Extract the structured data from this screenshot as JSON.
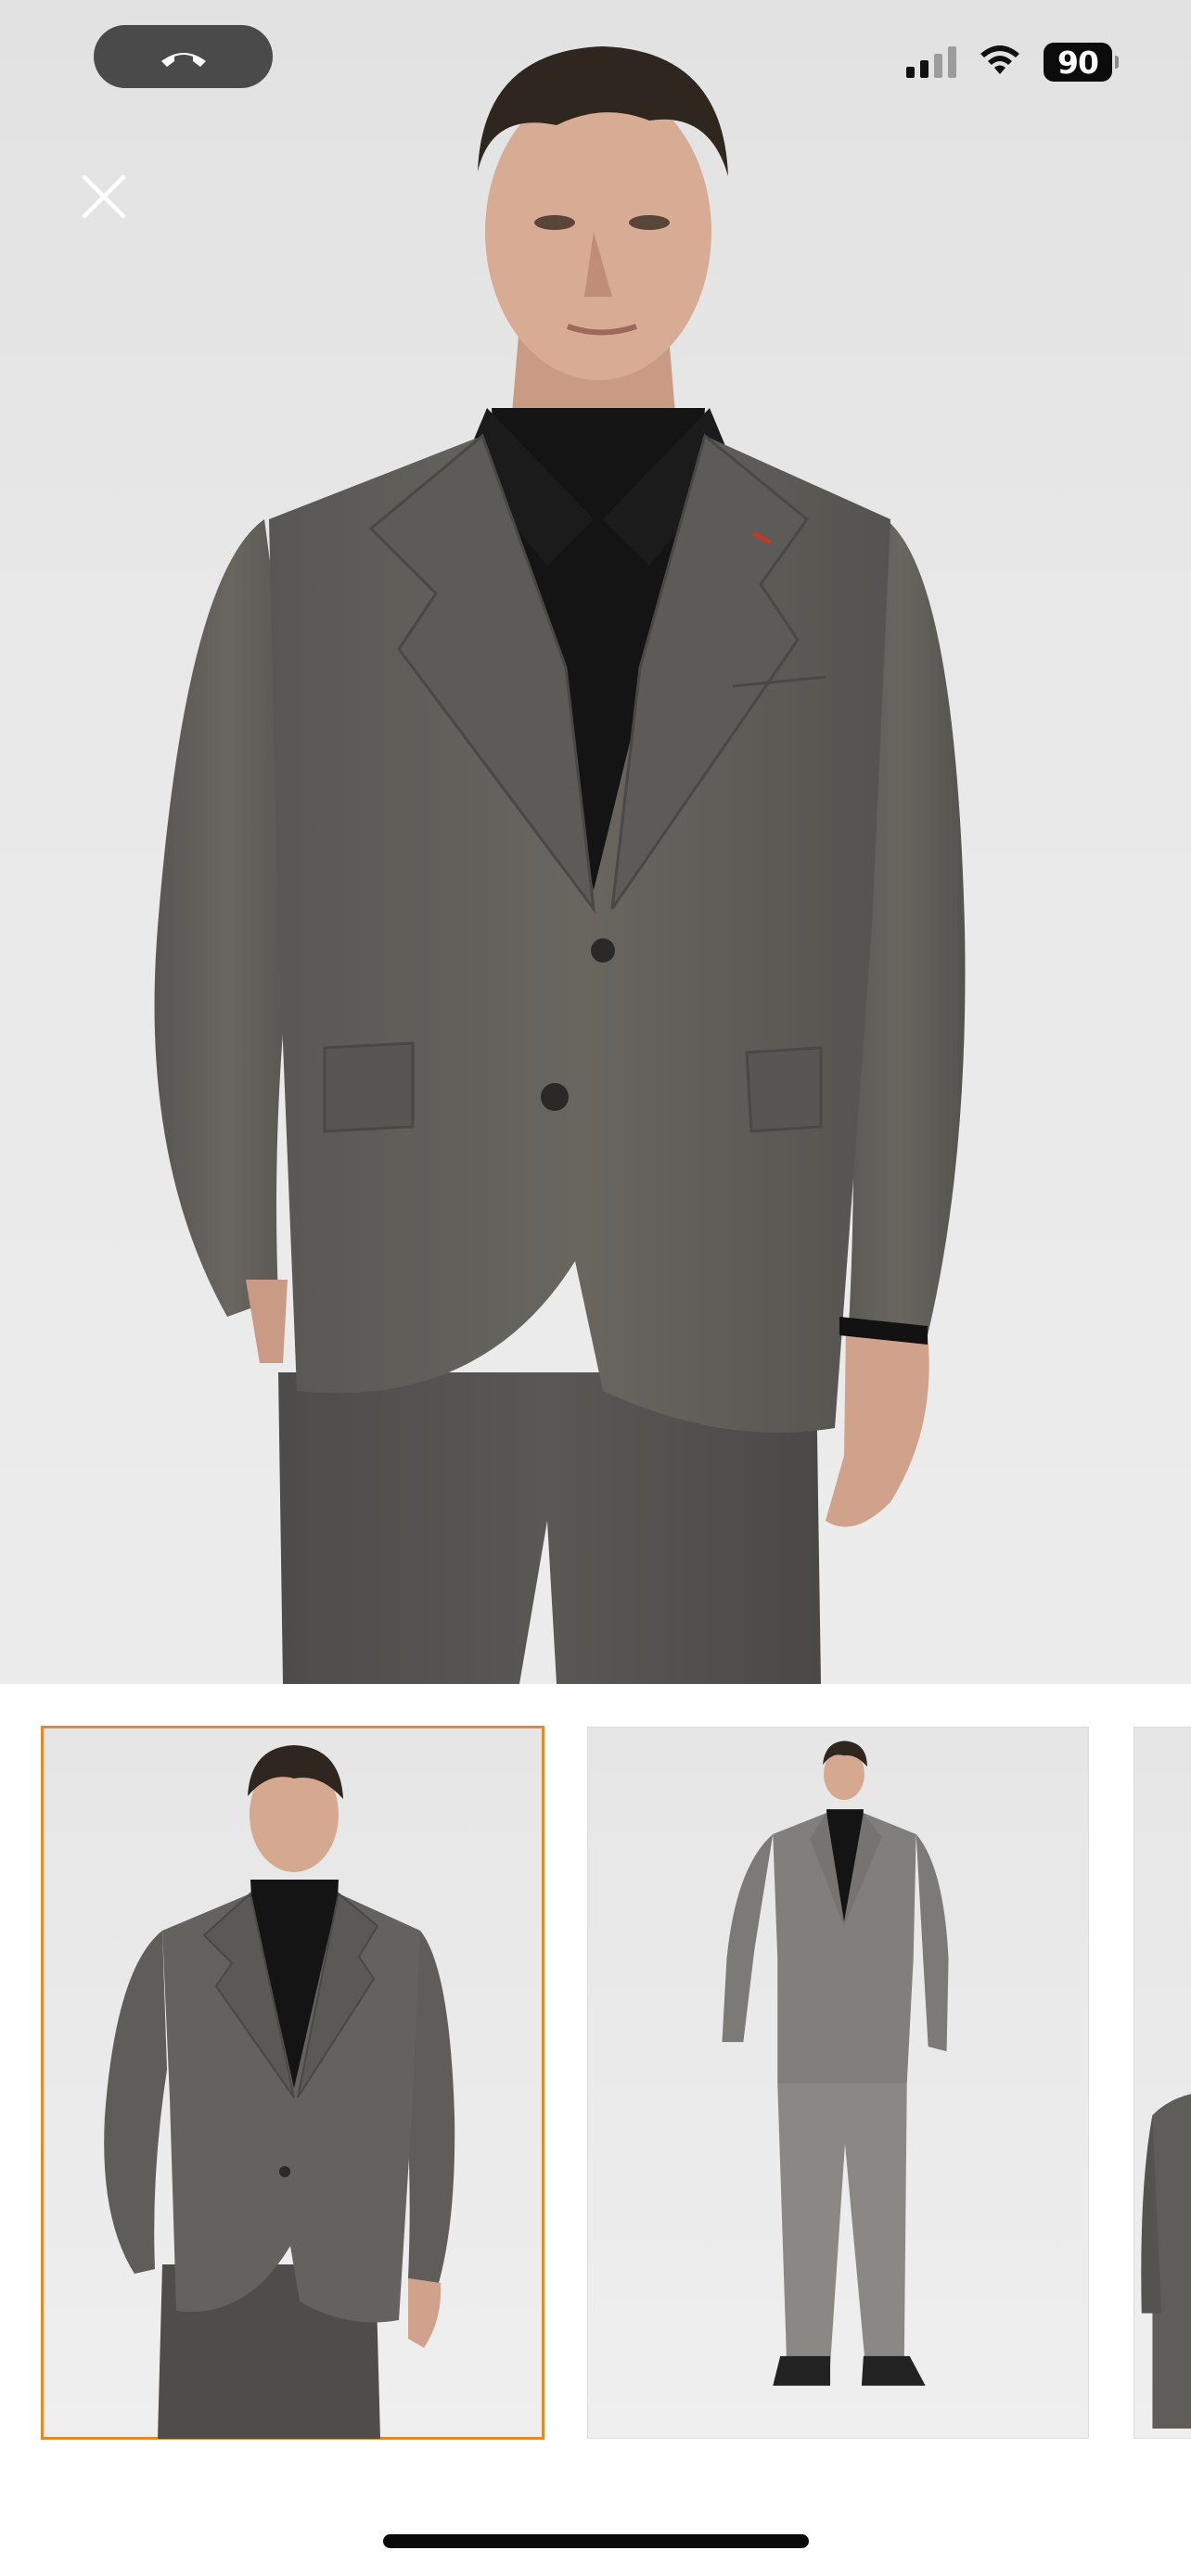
{
  "status_bar": {
    "battery_level": "90",
    "call_icon": "phone-hangup-icon",
    "signal_icon": "cellular-signal-icon",
    "wifi_icon": "wifi-icon"
  },
  "viewer": {
    "close_icon": "close-icon",
    "main_image": "grey-suit-front-closeup",
    "selected_thumbnail_index": 0
  },
  "thumbnails": [
    {
      "image": "grey-suit-front-closeup",
      "selected": true
    },
    {
      "image": "grey-suit-full-length",
      "selected": false
    },
    {
      "image": "grey-suit-side-partial",
      "selected": false
    }
  ],
  "colors": {
    "selected_outline": "#e38a2c",
    "suit_grey": "#5f5d5a",
    "shirt_black": "#121212"
  }
}
